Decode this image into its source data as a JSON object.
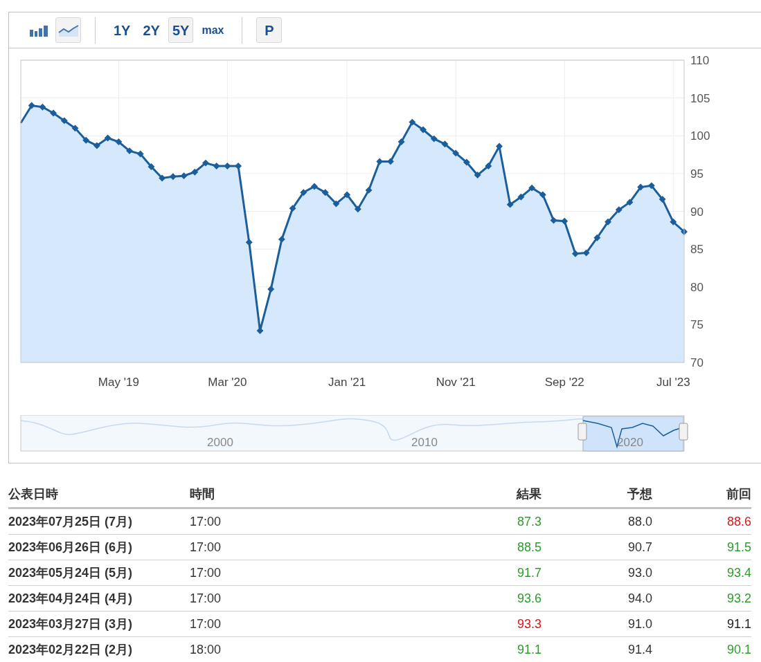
{
  "toolbar": {
    "chart_types": [
      {
        "kind": "bar",
        "selected": false
      },
      {
        "kind": "area",
        "selected": true
      }
    ],
    "ranges": [
      {
        "label": "1Y",
        "selected": false
      },
      {
        "label": "2Y",
        "selected": false
      },
      {
        "label": "5Y",
        "selected": true
      },
      {
        "label": "max",
        "selected": false
      }
    ],
    "extra_button": {
      "label": "P"
    }
  },
  "chart_data": {
    "type": "area",
    "grid": true,
    "ylim": [
      70,
      110
    ],
    "yticks": [
      70,
      75,
      80,
      85,
      90,
      95,
      100,
      105,
      110
    ],
    "categories": [
      null,
      null,
      null,
      null,
      null,
      null,
      null,
      null,
      null,
      "May '19",
      null,
      null,
      null,
      null,
      null,
      null,
      null,
      null,
      null,
      "Mar '20",
      null,
      null,
      null,
      null,
      null,
      null,
      null,
      null,
      null,
      null,
      "Jan '21",
      null,
      null,
      null,
      null,
      null,
      null,
      null,
      null,
      null,
      "Nov '21",
      null,
      null,
      null,
      null,
      null,
      null,
      null,
      null,
      null,
      "Sep '22",
      null,
      null,
      null,
      null,
      null,
      null,
      null,
      null,
      null,
      "Jul '23",
      null
    ],
    "series": [
      {
        "color": "#1b5e9c",
        "values": [
          101.7,
          104.0,
          103.8,
          103.0,
          102.0,
          101.0,
          99.4,
          98.7,
          99.7,
          99.2,
          98.0,
          97.6,
          95.9,
          94.4,
          94.6,
          94.7,
          95.2,
          96.4,
          96.0,
          96.0,
          96.0,
          85.9,
          74.2,
          79.7,
          86.3,
          90.4,
          92.5,
          93.3,
          92.5,
          91.0,
          92.2,
          90.3,
          92.8,
          96.6,
          96.6,
          99.2,
          101.8,
          100.8,
          99.6,
          98.9,
          97.7,
          96.5,
          94.8,
          96.0,
          98.6,
          90.9,
          91.9,
          93.1,
          92.2,
          88.8,
          88.7,
          84.4,
          84.5,
          86.5,
          88.6,
          90.2,
          91.2,
          93.2,
          93.4,
          91.6,
          88.6,
          87.3
        ]
      }
    ]
  },
  "navigator": {
    "labels": [
      "2000",
      "2010",
      "2020"
    ]
  },
  "table": {
    "columns": [
      "公表日時",
      "時間",
      "結果",
      "予想",
      "前回"
    ],
    "rows": [
      {
        "date": "2023年07月25日 (7月)",
        "time": "17:00",
        "actual": {
          "text": "87.3",
          "color": "#2a9d2a"
        },
        "forecast": "88.0",
        "previous": {
          "text": "88.6",
          "color": "#e0131b"
        }
      },
      {
        "date": "2023年06月26日 (6月)",
        "time": "17:00",
        "actual": {
          "text": "88.5",
          "color": "#2a9d2a"
        },
        "forecast": "90.7",
        "previous": {
          "text": "91.5",
          "color": "#2a9d2a"
        }
      },
      {
        "date": "2023年05月24日 (5月)",
        "time": "17:00",
        "actual": {
          "text": "91.7",
          "color": "#2a9d2a"
        },
        "forecast": "93.0",
        "previous": {
          "text": "93.4",
          "color": "#2a9d2a"
        }
      },
      {
        "date": "2023年04月24日 (4月)",
        "time": "17:00",
        "actual": {
          "text": "93.6",
          "color": "#2a9d2a"
        },
        "forecast": "94.0",
        "previous": {
          "text": "93.2",
          "color": "#2a9d2a"
        }
      },
      {
        "date": "2023年03月27日 (3月)",
        "time": "17:00",
        "actual": {
          "text": "93.3",
          "color": "#e0131b"
        },
        "forecast": "91.0",
        "previous": {
          "text": "91.1",
          "color": "#222222"
        }
      },
      {
        "date": "2023年02月22日 (2月)",
        "time": "18:00",
        "actual": {
          "text": "91.1",
          "color": "#2a9d2a"
        },
        "forecast": "91.4",
        "previous": {
          "text": "90.1",
          "color": "#2a9d2a"
        }
      }
    ]
  }
}
